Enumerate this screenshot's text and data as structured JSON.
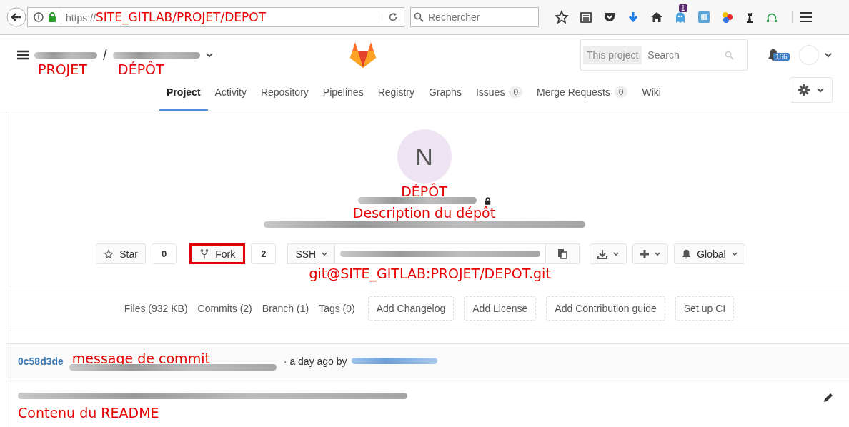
{
  "browser": {
    "url_prefix": "https://",
    "url_annotation": "SITE_GITLAB/PROJET/DEPOT",
    "search_placeholder": "Rechercher",
    "extension_badge": "1"
  },
  "header": {
    "separator": "/",
    "project_annotation": "PROJET",
    "repo_annotation": "DÉPÔT",
    "search_scope": "This project",
    "search_placeholder": "Search",
    "notification_count": "166"
  },
  "nav": [
    {
      "label": "Project",
      "selected": true
    },
    {
      "label": "Activity",
      "selected": false
    },
    {
      "label": "Repository",
      "selected": false
    },
    {
      "label": "Pipelines",
      "selected": false
    },
    {
      "label": "Registry",
      "selected": false
    },
    {
      "label": "Graphs",
      "selected": false
    },
    {
      "label": "Issues",
      "count": "0",
      "selected": false
    },
    {
      "label": "Merge Requests",
      "count": "0",
      "selected": false
    },
    {
      "label": "Wiki",
      "selected": false
    }
  ],
  "project": {
    "avatar_letter": "N",
    "name_annotation": "DÉPÔT",
    "description_annotation": "Description du dépôt"
  },
  "actions": {
    "star": {
      "label": "Star",
      "count": "0",
      "highlighted": false
    },
    "fork": {
      "label": "Fork",
      "count": "2",
      "highlighted": true
    },
    "protocol": "SSH",
    "url_annotation": "git@SITE_GITLAB:PROJET/DEPOT.git",
    "notification": "Global"
  },
  "stats": [
    {
      "label": "Files (932 KB)",
      "kind": "link"
    },
    {
      "label": "Commits (2)",
      "kind": "link"
    },
    {
      "label": "Branch (1)",
      "kind": "link"
    },
    {
      "label": "Tags (0)",
      "kind": "link"
    },
    {
      "label": "Add Changelog",
      "kind": "dashed"
    },
    {
      "label": "Add License",
      "kind": "dashed"
    },
    {
      "label": "Add Contribution guide",
      "kind": "dashed"
    },
    {
      "label": "Set up CI",
      "kind": "dashed"
    }
  ],
  "commit": {
    "sha": "0c58d3de",
    "message_annotation": "message de commit",
    "meta": "· a day ago by"
  },
  "readme": {
    "annotation": "Contenu du README"
  }
}
